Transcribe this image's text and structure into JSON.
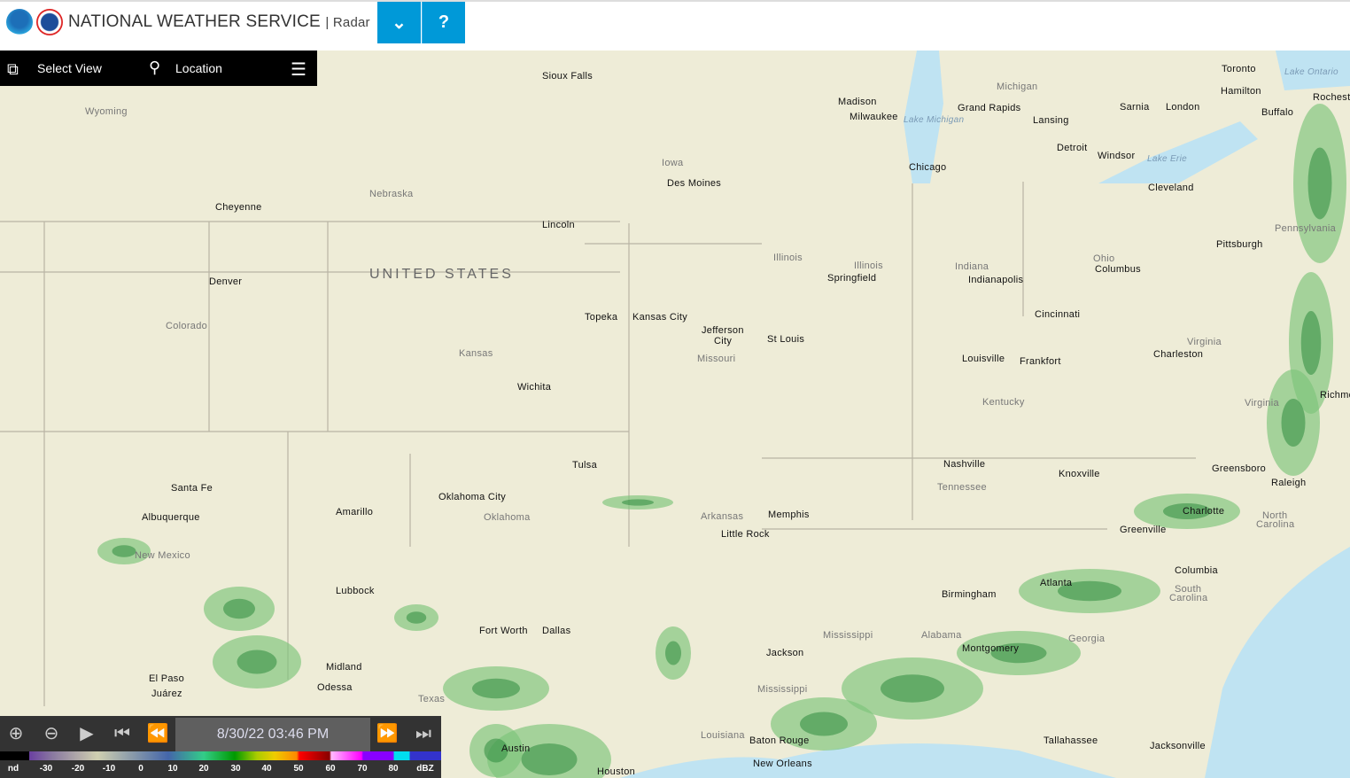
{
  "header": {
    "title": "NATIONAL WEATHER SERVICE",
    "subtitle": "| Radar",
    "dropdown_icon": "chevron-down-icon",
    "help_label": "?"
  },
  "toolbar": {
    "select_view": "Select View",
    "location": "Location"
  },
  "map": {
    "country_label": "UNITED STATES",
    "cities": [
      "Sioux Falls",
      "Madison",
      "Milwaukee",
      "Grand Rapids",
      "Lansing",
      "Toronto",
      "Hamilton",
      "London",
      "Sarnia",
      "Buffalo",
      "Rochester",
      "Detroit",
      "Windsor",
      "Chicago",
      "Cleveland",
      "Des Moines",
      "Cheyenne",
      "Lincoln",
      "Pittsburgh",
      "Denver",
      "Springfield",
      "Indianapolis",
      "Columbus",
      "Topeka",
      "Kansas City",
      "Jefferson",
      "City",
      "St Louis",
      "Cincinnati",
      "Louisville",
      "Frankfort",
      "Charleston",
      "Wichita",
      "Richmond",
      "Tulsa",
      "Nashville",
      "Knoxville",
      "Greensboro",
      "Raleigh",
      "Santa Fe",
      "Oklahoma City",
      "Amarillo",
      "Albuquerque",
      "Memphis",
      "Charlotte",
      "Little Rock",
      "Columbia",
      "Lubbock",
      "Birmingham",
      "Atlanta",
      "Fort Worth",
      "Dallas",
      "Jackson",
      "Montgomery",
      "Midland",
      "El Paso",
      "Juárez",
      "Odessa",
      "Baton Rouge",
      "Tallahassee",
      "Jacksonville",
      "New Orleans",
      "Houston",
      "Austin",
      "Greenville"
    ],
    "regions": [
      "Wyoming",
      "Michigan",
      "Iowa",
      "Nebraska",
      "Illinois",
      "Illinois",
      "Indiana",
      "Ohio",
      "Pennsylvania",
      "Colorado",
      "Kansas",
      "Missouri",
      "Kentucky",
      "Virginia",
      "Virginia",
      "Tennessee",
      "Oklahoma",
      "Arkansas",
      "New Mexico",
      "North",
      "Carolina",
      "South",
      "Carolina",
      "Georgia",
      "Mississippi",
      "Alabama",
      "Texas",
      "Louisiana",
      "Mississippi"
    ],
    "lakes": [
      "Lake Michigan",
      "Lake Erie",
      "Lake Ontario"
    ]
  },
  "controls": {
    "timestamp": "8/30/22 03:46 PM",
    "legend_ticks": [
      "nd",
      "-30",
      "-20",
      "-10",
      "0",
      "10",
      "20",
      "30",
      "40",
      "50",
      "60",
      "70",
      "80",
      "dBZ"
    ]
  },
  "colors": {
    "accent": "#0099d8",
    "land": "#eeecd7",
    "water": "#bfe3f2",
    "radar_light": "#7cc47a",
    "radar_dark": "#2e8b3e"
  }
}
